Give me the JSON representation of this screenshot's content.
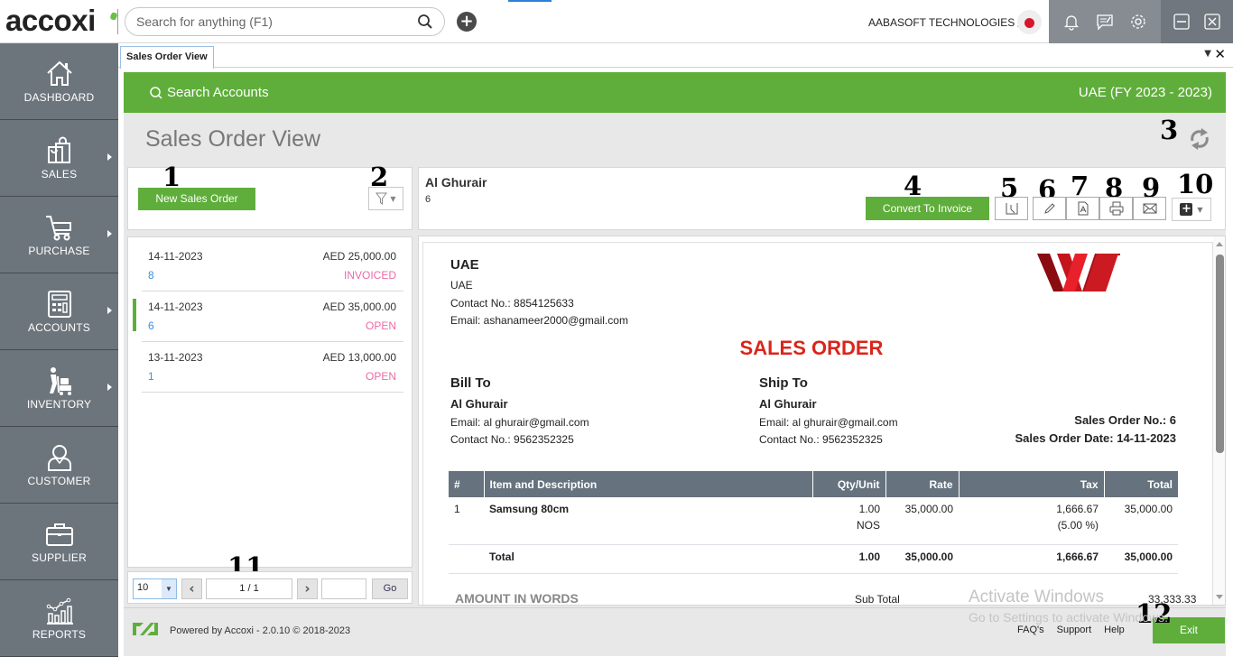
{
  "topbar": {
    "logo": "accoxi",
    "search_placeholder": "Search for anything (F1)",
    "company": "AABASOFT TECHNOLOGIES",
    "icons": [
      "search-icon",
      "add-icon",
      "bell-icon",
      "chat-icon",
      "gear-icon",
      "minimize-icon",
      "close-icon"
    ]
  },
  "sidebar": {
    "items": [
      {
        "label": "DASHBOARD",
        "icon": "home-icon",
        "has_submenu": false
      },
      {
        "label": "SALES",
        "icon": "shopping-bag-icon",
        "has_submenu": true
      },
      {
        "label": "PURCHASE",
        "icon": "cart-icon",
        "has_submenu": true
      },
      {
        "label": "ACCOUNTS",
        "icon": "calculator-icon",
        "has_submenu": true
      },
      {
        "label": "INVENTORY",
        "icon": "trolley-icon",
        "has_submenu": true
      },
      {
        "label": "CUSTOMER",
        "icon": "user-icon",
        "has_submenu": false
      },
      {
        "label": "SUPPLIER",
        "icon": "briefcase-icon",
        "has_submenu": false
      },
      {
        "label": "REPORTS",
        "icon": "chart-icon",
        "has_submenu": false
      }
    ]
  },
  "tabs": [
    {
      "label": "Sales Order View",
      "active": true
    }
  ],
  "header": {
    "search_accounts": "Search Accounts",
    "fiscal": "UAE (FY 2023 - 2023)",
    "page_title": "Sales Order View"
  },
  "annotations": [
    "1",
    "2",
    "3",
    "4",
    "5",
    "6",
    "7",
    "8",
    "9",
    "10",
    "11",
    "12"
  ],
  "left_panel": {
    "new_button": "New Sales Order",
    "orders": [
      {
        "date": "14-11-2023",
        "amount": "AED 25,000.00",
        "number": "8",
        "status": "INVOICED",
        "selected": false
      },
      {
        "date": "14-11-2023",
        "amount": "AED 35,000.00",
        "number": "6",
        "status": "OPEN",
        "selected": true
      },
      {
        "date": "13-11-2023",
        "amount": "AED 13,000.00",
        "number": "1",
        "status": "OPEN",
        "selected": false
      }
    ],
    "pager": {
      "page_size": "10",
      "page": "1 / 1",
      "go_label": "Go",
      "goto_value": ""
    }
  },
  "detail": {
    "customer": "Al Ghurair",
    "order_no": "6",
    "convert_button": "Convert To Invoice",
    "action_icons": [
      "clock-icon",
      "edit-icon",
      "pdf-icon",
      "print-icon",
      "mail-icon",
      "more-add-icon"
    ]
  },
  "document": {
    "company_name": "UAE",
    "company_line": "UAE",
    "company_contact": "Contact No.: 8854125633",
    "company_email": "Email: ashanameer2000@gmail.com",
    "title": "SALES ORDER",
    "bill_to": {
      "heading": "Bill To",
      "name": "Al Ghurair",
      "email": "Email: al ghurair@gmail.com",
      "contact": "Contact No.: 9562352325"
    },
    "ship_to": {
      "heading": "Ship To",
      "name": "Al Ghurair",
      "email": "Email: al ghurair@gmail.com",
      "contact": "Contact No.: 9562352325"
    },
    "so_no": "Sales Order No.: 6",
    "so_date": "Sales Order Date: 14-11-2023",
    "columns": [
      "#",
      "Item and Description",
      "Qty/Unit",
      "Rate",
      "Tax",
      "Total"
    ],
    "rows": [
      {
        "no": "1",
        "item": "Samsung 80cm",
        "qty": "1.00",
        "unit": "NOS",
        "rate": "35,000.00",
        "tax": "1,666.67",
        "tax_pct": "(5.00 %)",
        "total": "35,000.00"
      }
    ],
    "totals": {
      "label": "Total",
      "qty": "1.00",
      "rate": "35,000.00",
      "tax": "1,666.67",
      "total": "35,000.00"
    },
    "amount_in_words": "AMOUNT IN WORDS",
    "sub_total_label": "Sub Total",
    "sub_total_value": "33,333.33"
  },
  "watermark": {
    "line1": "Activate Windows",
    "line2": "Go to Settings to activate Windows."
  },
  "footer": {
    "powered": "Powered by Accoxi - 2.0.10 © 2018-2023",
    "links": [
      "FAQ's",
      "Support",
      "Help"
    ],
    "exit": "Exit"
  },
  "colors": {
    "brand_green": "#5fae3b",
    "sidebar": "#6d757c",
    "title_red": "#d9261c",
    "status_pink": "#ec6aa8",
    "link_blue": "#3d8fe0",
    "table_header": "#66727e"
  }
}
